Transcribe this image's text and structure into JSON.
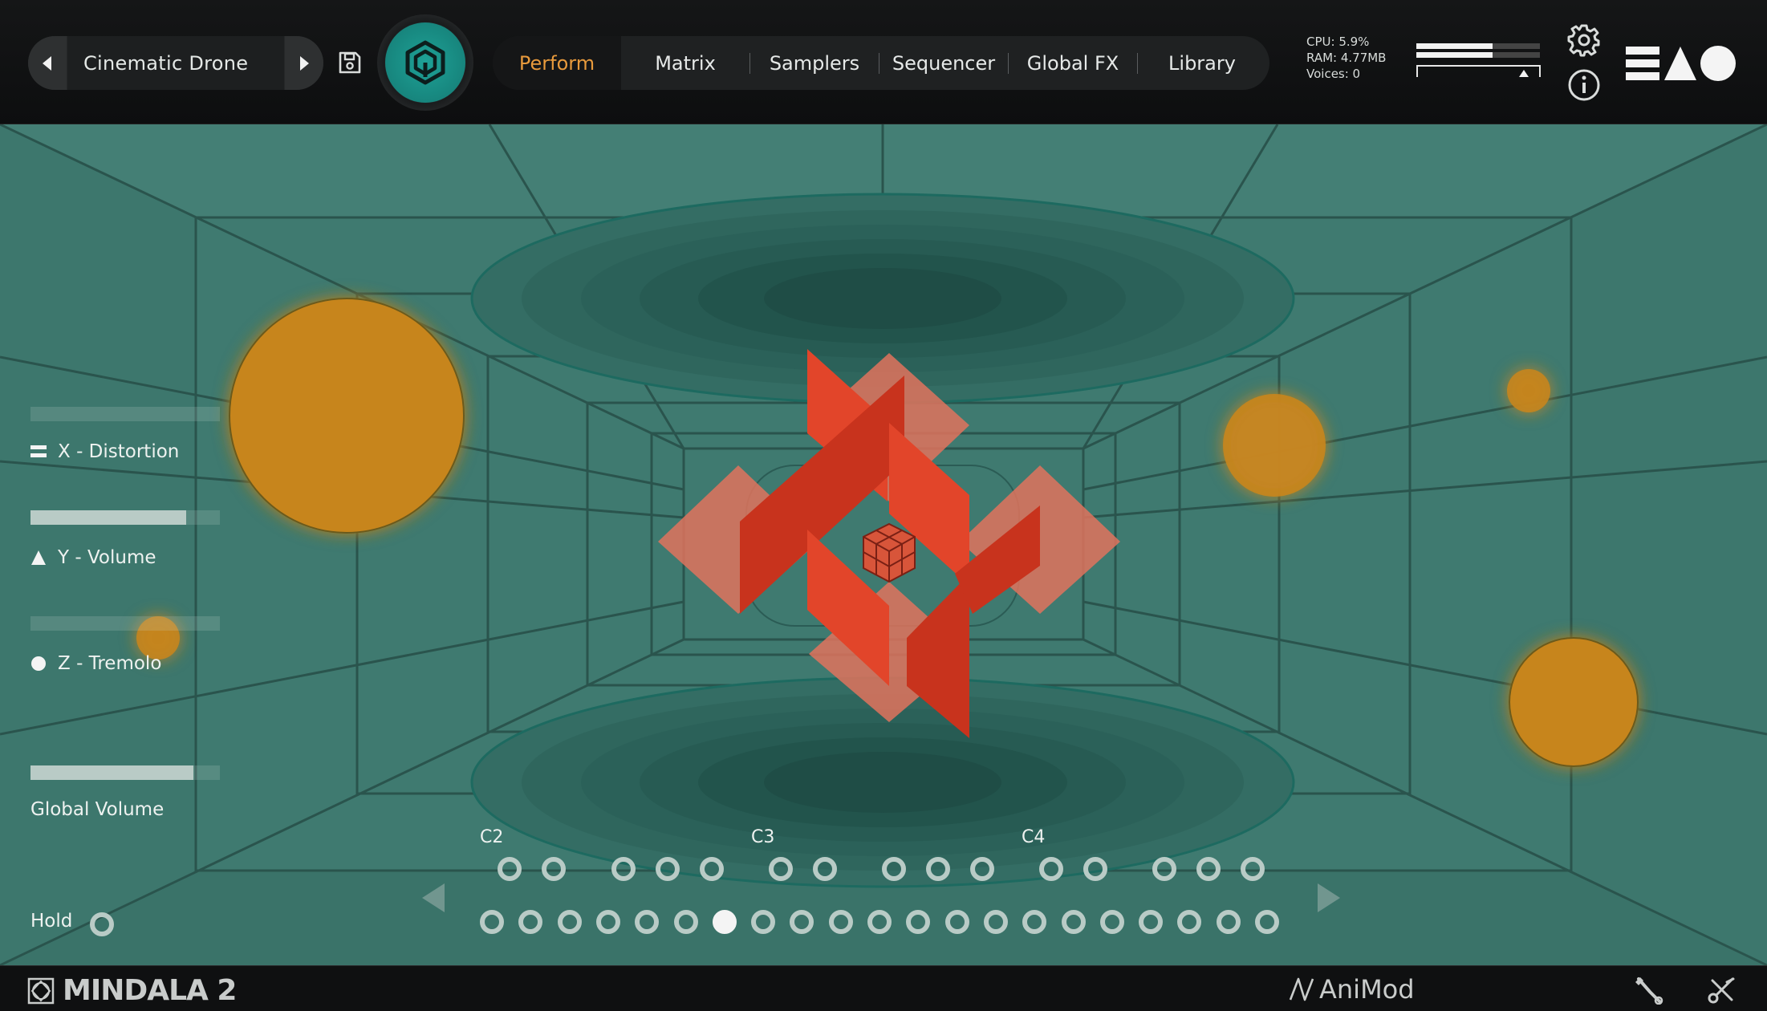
{
  "header": {
    "preset_name": "Cinematic Drone",
    "tabs": [
      {
        "label": "Perform",
        "active": true
      },
      {
        "label": "Matrix",
        "active": false
      },
      {
        "label": "Samplers",
        "active": false
      },
      {
        "label": "Sequencer",
        "active": false
      },
      {
        "label": "Global FX",
        "active": false
      },
      {
        "label": "Library",
        "active": false
      }
    ],
    "stats": {
      "cpu": "CPU: 5.9%",
      "ram": "RAM: 4.77MB",
      "voices": "Voices: 0"
    },
    "output_meter": {
      "left_level": 0.62,
      "right_level": 0.62
    }
  },
  "left_panel": {
    "x_label": "X - Distortion",
    "x_value": 0.0,
    "y_label": "Y - Volume",
    "y_value": 0.82,
    "z_label": "Z - Tremolo",
    "z_value": 0.0,
    "global_volume_label": "Global Volume",
    "global_volume_value": 0.86,
    "hold_label": "Hold"
  },
  "keyboard": {
    "octave_labels": [
      "C2",
      "C3",
      "C4"
    ],
    "active_key_index": 6
  },
  "footer": {
    "product_name": "MINDALA 2",
    "animod_label": "AniMod"
  },
  "colors": {
    "accent": "#e89a3c",
    "stage_bg": "#3f7a70",
    "orb": "#c7851f",
    "shape": "#e24a2a",
    "logo": "#1ea196"
  },
  "icons": [
    "chevron-left-icon",
    "chevron-right-icon",
    "save-icon",
    "hex-logo-icon",
    "gear-icon",
    "info-icon",
    "brand-shapes-icon",
    "mindala-logo-icon",
    "animod-logo-icon",
    "wrench-icon",
    "scissors-icon",
    "triangle-left-icon",
    "triangle-right-icon"
  ]
}
